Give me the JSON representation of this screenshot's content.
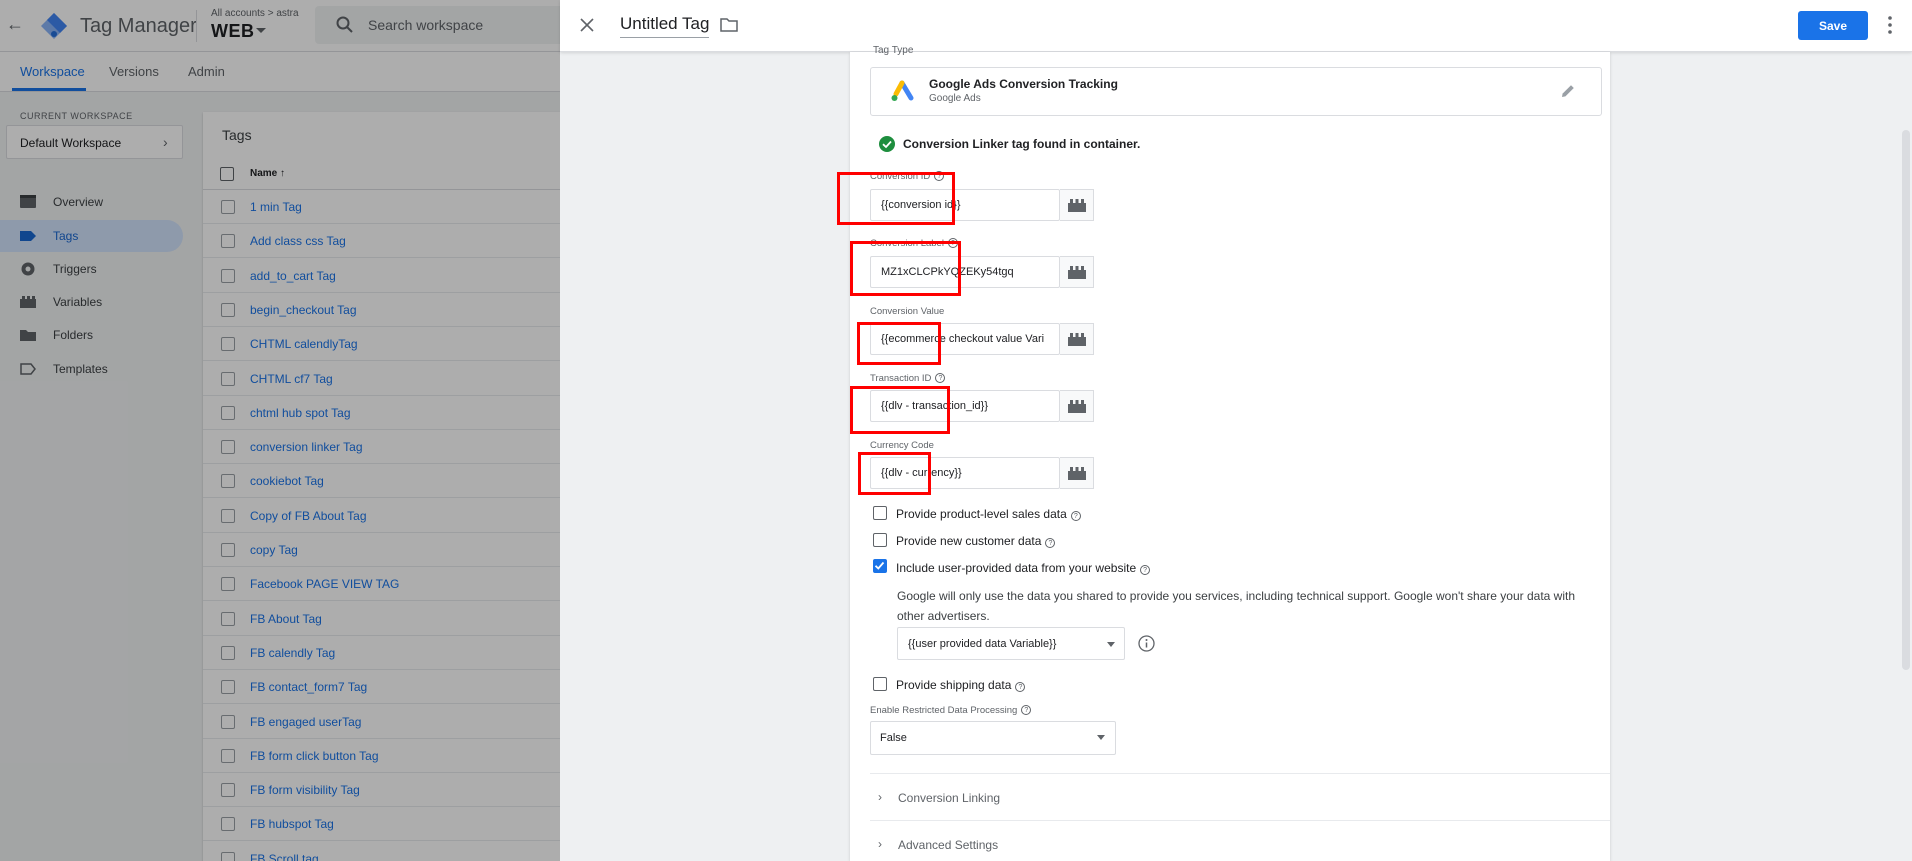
{
  "app": {
    "name": "Tag Manager",
    "breadcrumb": "All accounts > astra",
    "container": "WEB",
    "search_placeholder": "Search workspace"
  },
  "nav_tabs": [
    {
      "label": "Workspace",
      "active": true
    },
    {
      "label": "Versions",
      "active": false
    },
    {
      "label": "Admin",
      "active": false
    }
  ],
  "workspace": {
    "label": "CURRENT WORKSPACE",
    "name": "Default Workspace"
  },
  "sidebar": [
    {
      "label": "Overview",
      "icon": "overview-icon",
      "active": false
    },
    {
      "label": "Tags",
      "icon": "tag-icon",
      "active": true
    },
    {
      "label": "Triggers",
      "icon": "trigger-icon",
      "active": false
    },
    {
      "label": "Variables",
      "icon": "variables-icon",
      "active": false
    },
    {
      "label": "Folders",
      "icon": "folder-icon",
      "active": false
    },
    {
      "label": "Templates",
      "icon": "template-icon",
      "active": false
    }
  ],
  "tags_list": {
    "title": "Tags",
    "column_name": "Name ↑",
    "rows": [
      "1 min Tag",
      "Add class css Tag",
      "add_to_cart Tag",
      "begin_checkout Tag",
      "CHTML calendlyTag",
      "CHTML cf7 Tag",
      "chtml hub spot Tag",
      "conversion linker Tag",
      "cookiebot Tag",
      "Copy of FB About Tag",
      "copy Tag",
      "Facebook PAGE VIEW TAG",
      "FB About Tag",
      "FB calendly Tag",
      "FB contact_form7 Tag",
      "FB engaged userTag",
      "FB form click button Tag",
      "FB form visibility Tag",
      "FB hubspot Tag",
      "FB Scroll tag"
    ]
  },
  "editor": {
    "title": "Untitled Tag",
    "save_label": "Save",
    "tag_type_label": "Tag Type",
    "tag_type": {
      "title": "Google Ads Conversion Tracking",
      "subtitle": "Google Ads"
    },
    "linker_message": "Conversion Linker tag found in container.",
    "fields": [
      {
        "label": "Conversion ID",
        "value": "{{conversion id}}",
        "help": true
      },
      {
        "label": "Conversion Label",
        "value": "MZ1xCLCPkYQZEKy54tgq",
        "help": true
      },
      {
        "label": "Conversion Value",
        "value": "{{ecommerce checkout value Vari",
        "help": false
      },
      {
        "label": "Transaction ID",
        "value": "{{dlv - transaction_id}}",
        "help": true
      },
      {
        "label": "Currency Code",
        "value": "{{dlv - currency}}",
        "help": false
      }
    ],
    "checkboxes": [
      {
        "label": "Provide product-level sales data",
        "checked": false
      },
      {
        "label": "Provide new customer data",
        "checked": false
      },
      {
        "label": "Include user-provided data from your website",
        "checked": true
      }
    ],
    "user_data_explanation": "Google will only use the data you shared to provide you services, including technical support. Google won't share your data with other advertisers.",
    "user_data_variable": "{{user provided data Variable}}",
    "shipping_label": "Provide shipping data",
    "rdp": {
      "label": "Enable Restricted Data Processing",
      "value": "False"
    },
    "sections": [
      "Conversion Linking",
      "Advanced Settings"
    ]
  },
  "colors": {
    "accent": "#1a73e8",
    "highlight_box": "#ff0000",
    "success": "#1e8e3e"
  }
}
